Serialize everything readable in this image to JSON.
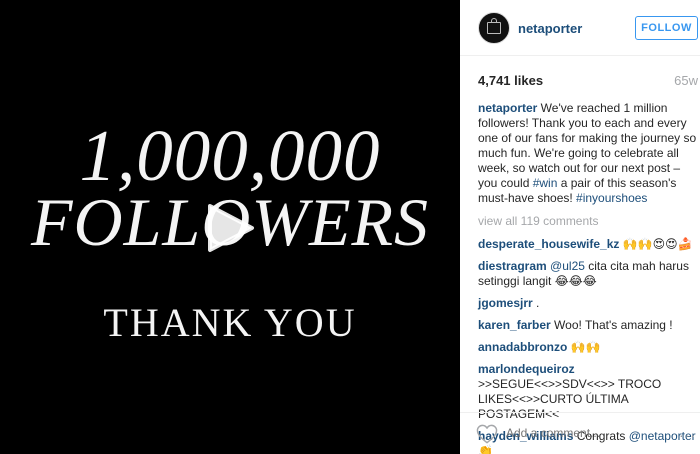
{
  "media": {
    "line1": "1,000,000",
    "line2": "FOLLOWERS",
    "line3": "THANK YOU"
  },
  "header": {
    "username": "netaporter",
    "follow_label": "FOLLOW"
  },
  "stats": {
    "likes": "4,741 likes",
    "age": "65w"
  },
  "caption": {
    "user": "netaporter",
    "text_a": " We've reached 1 million followers! Thank you to each and every one of our fans for making the journey so much fun. We're going to celebrate all week, so watch out for our next post – you could ",
    "tag1": "#win",
    "text_b": " a pair of this season's must-have shoes! ",
    "tag2": "#inyourshoes"
  },
  "view_all": "view all 119 comments",
  "comments": [
    {
      "user": "desperate_housewife_kz",
      "text": " 🙌🙌😍😍🍰"
    },
    {
      "user": "diestragram",
      "mention": "@ul25",
      "text": " cita cita mah harus setinggi langit 😂😂😂"
    },
    {
      "user": "jgomesjrr",
      "text": " ."
    },
    {
      "user": "karen_farber",
      "text": " Woo! That's amazing !"
    },
    {
      "user": "annadabbronzo",
      "text": " 🙌🙌"
    },
    {
      "user": "marlondequeiroz",
      "text": " >>SEGUE<<>>SDV<<>> TROCO LIKES<<>>CURTO ÚLTIMA POSTAGEM<<"
    },
    {
      "user": "hayden_williams",
      "text": " Congrats ",
      "mention": "@netaporter",
      "tail": " 👏"
    }
  ],
  "footer": {
    "comment_placeholder": "Add a comment...",
    "more": "···"
  }
}
